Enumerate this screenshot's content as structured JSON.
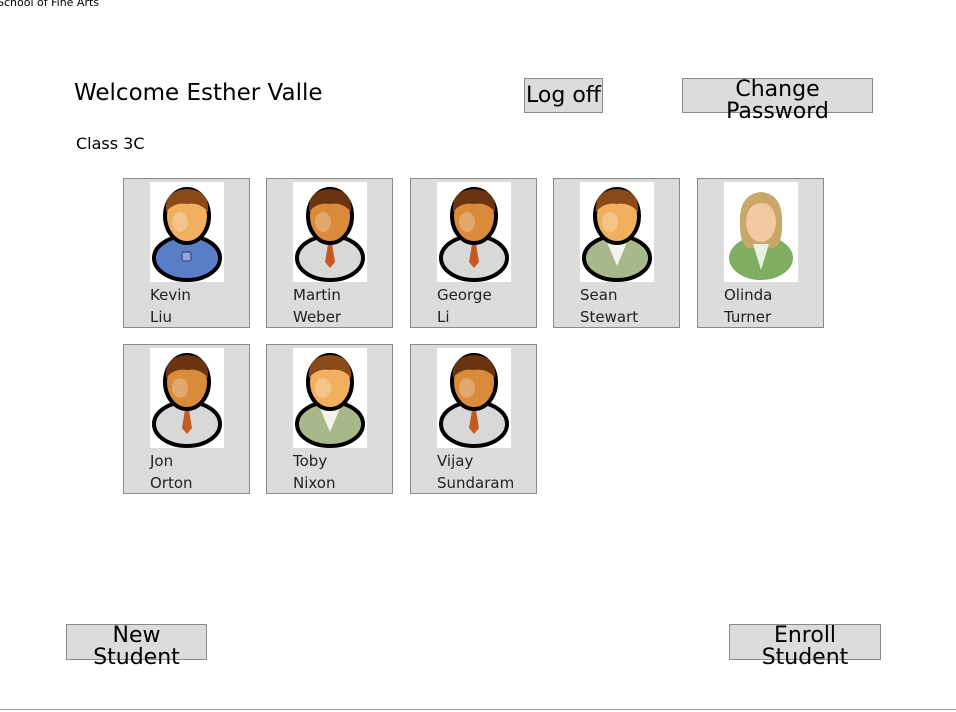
{
  "window": {
    "title": "School of Fine Arts"
  },
  "header": {
    "welcome": "Welcome Esther Valle",
    "log_off_label": "Log off",
    "change_password_label": "Change Password"
  },
  "class_label": "Class 3C",
  "students": [
    {
      "first": "Kevin",
      "last": "Liu",
      "icon": "male-student-sweater-icon",
      "skin": "#f0b060",
      "hair": "#8a4a18",
      "body": "#5b7dc8"
    },
    {
      "first": "Martin",
      "last": "Weber",
      "icon": "male-student-tie-icon",
      "skin": "#d98a3a",
      "hair": "#6a3410",
      "body": "#d8d8d8"
    },
    {
      "first": "George",
      "last": "Li",
      "icon": "male-student-tie-icon",
      "skin": "#d98a3a",
      "hair": "#6a3410",
      "body": "#d8d8d8"
    },
    {
      "first": "Sean",
      "last": "Stewart",
      "icon": "male-student-jacket-icon",
      "skin": "#f0b060",
      "hair": "#8a4a18",
      "body": "#a9b88a"
    },
    {
      "first": "Olinda",
      "last": "Turner",
      "icon": "female-student-icon",
      "skin": "#f2c9a0",
      "hair": "#c9a66a",
      "body": "#7fae62"
    },
    {
      "first": "Jon",
      "last": "Orton",
      "icon": "male-student-tie-icon",
      "skin": "#d98a3a",
      "hair": "#6a3410",
      "body": "#d8d8d8"
    },
    {
      "first": "Toby",
      "last": "Nixon",
      "icon": "male-student-jacket-icon",
      "skin": "#f0b060",
      "hair": "#8a4a18",
      "body": "#a9b88a"
    },
    {
      "first": "Vijay",
      "last": "Sundaram",
      "icon": "male-student-tie-icon",
      "skin": "#d98a3a",
      "hair": "#6a3410",
      "body": "#d8d8d8"
    }
  ],
  "footer": {
    "new_student_label": "New Student",
    "enroll_student_label": "Enroll Student"
  }
}
